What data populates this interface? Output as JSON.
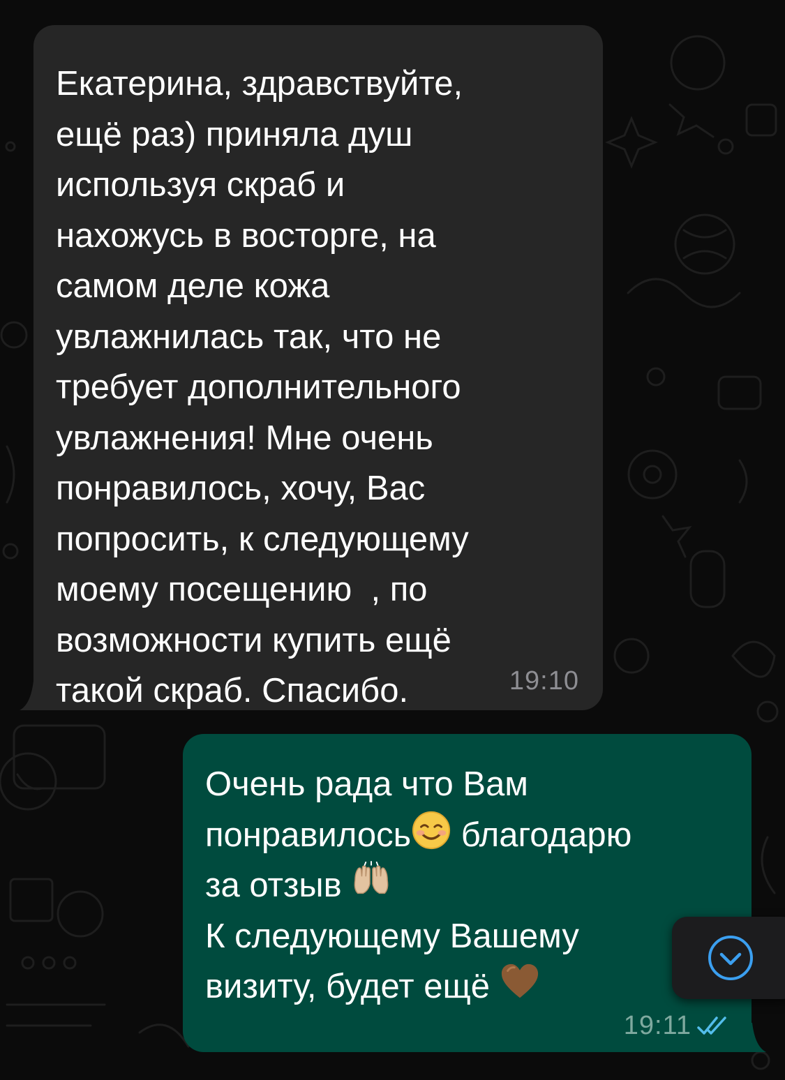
{
  "incoming_message": {
    "lines": [
      "Екатерина, здравствуйте,",
      "ещё раз) приняла душ",
      "используя скраб и",
      "нахожусь в восторге, на",
      "самом деле кожа",
      "увлажнилась так, что не",
      "требует дополнительного",
      "увлажнения! Мне очень",
      "понравилось, хочу, Вас",
      "попросить, к следующему",
      "моему посещению  , по",
      "возможности купить ещё",
      "такой скраб. Спасибо."
    ],
    "time": "19:10"
  },
  "outgoing_message": {
    "line1": "Очень рада что Вам",
    "line2": "понравилось",
    "line2_emoji": "smiling-face-icon",
    "line2_tail": " благодарю",
    "line3": "за отзыв ",
    "line3_emoji": "raising-hands-icon",
    "line4": "К следующему Вашему",
    "line5": "визиту, будет ещё ",
    "line5_emoji": "brown-heart-icon",
    "time": "19:11",
    "status_icon": "double-check-read-icon"
  },
  "scroll_to_bottom": {
    "icon": "chevron-down-circle-icon"
  },
  "colors": {
    "background": "#0b0b0b",
    "incoming_bubble": "#262626",
    "outgoing_bubble": "#004b3e",
    "read_ticks": "#53bdeb",
    "accent": "#3b9ff0"
  }
}
